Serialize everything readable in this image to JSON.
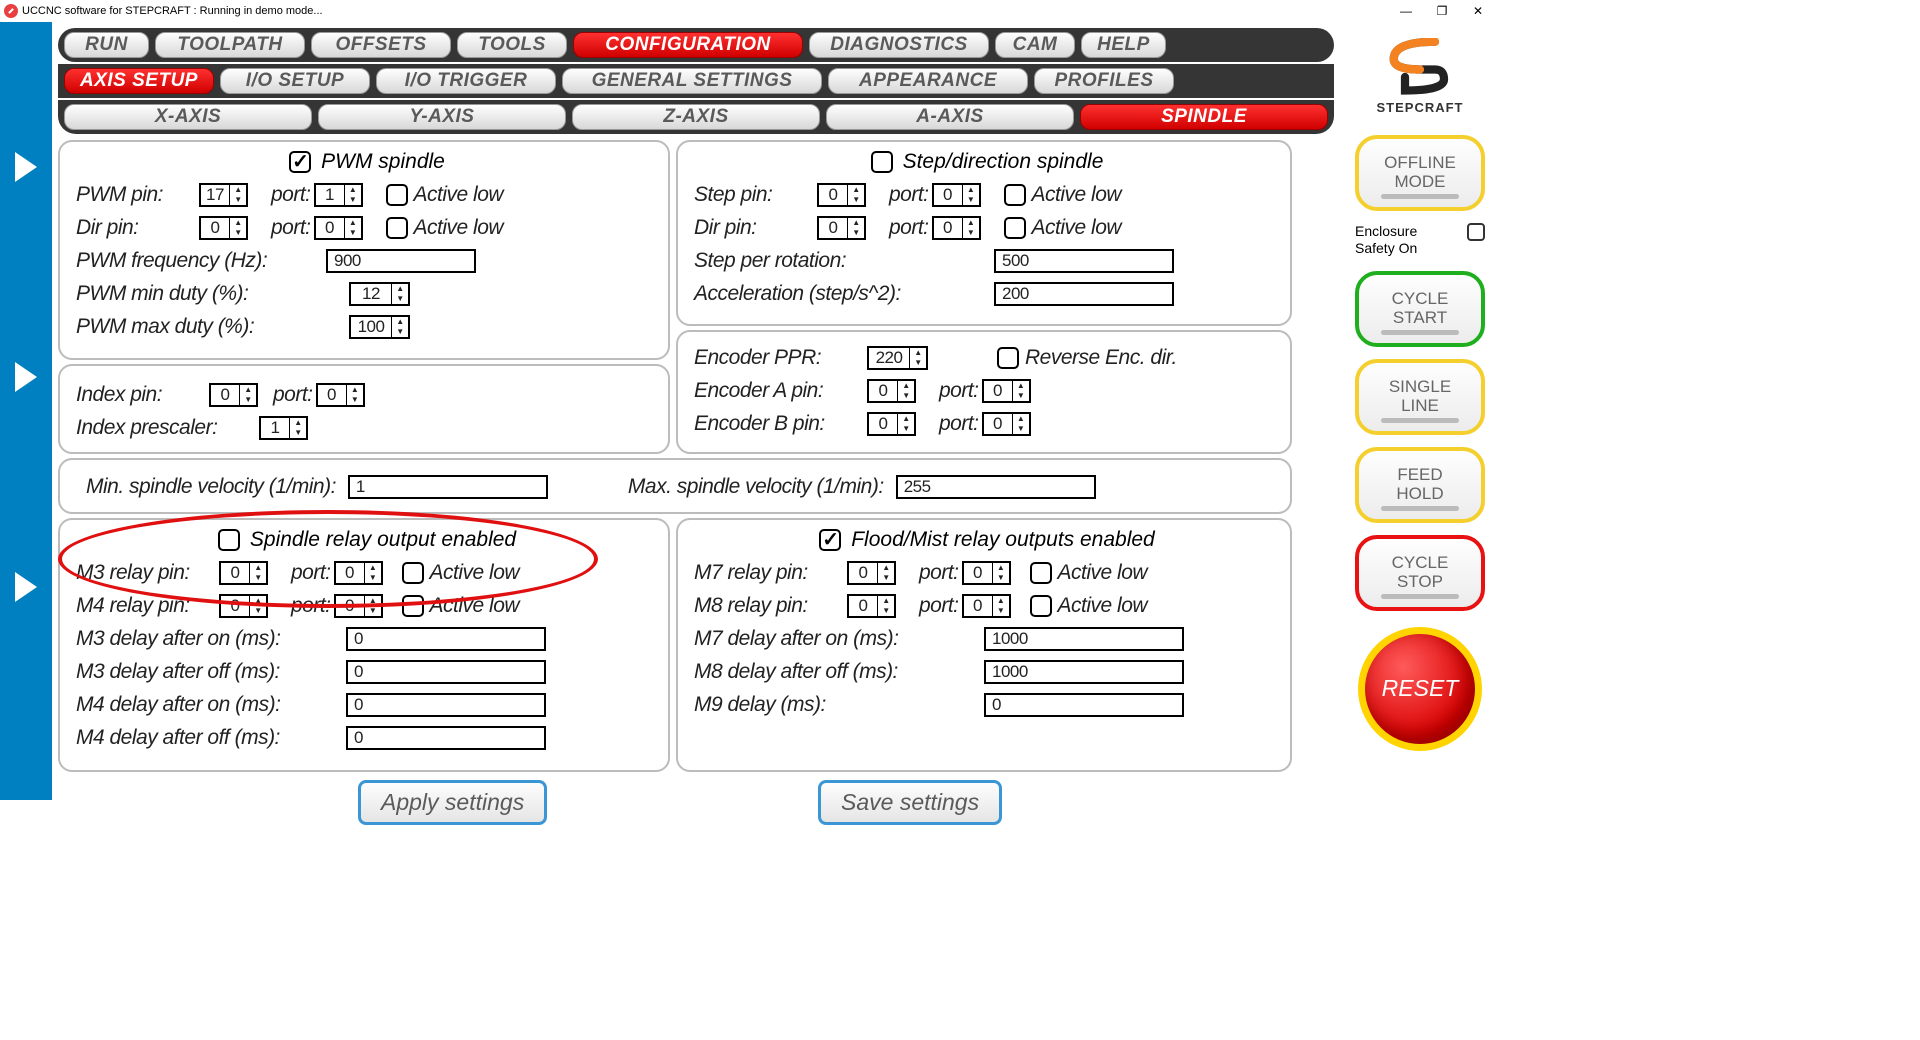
{
  "window": {
    "title": "UCCNC software for STEPCRAFT : Running in demo mode..."
  },
  "brand": "STEPCRAFT",
  "tabs_main": [
    "RUN",
    "TOOLPATH",
    "OFFSETS",
    "TOOLS",
    "CONFIGURATION",
    "DIAGNOSTICS",
    "CAM",
    "HELP"
  ],
  "tabs_main_active": "CONFIGURATION",
  "tabs_sub1": [
    "AXIS SETUP",
    "I/O SETUP",
    "I/O  TRIGGER",
    "GENERAL SETTINGS",
    "APPEARANCE",
    "PROFILES"
  ],
  "tabs_sub1_active": "AXIS SETUP",
  "tabs_sub2": [
    "X-AXIS",
    "Y-AXIS",
    "Z-AXIS",
    "A-AXIS",
    "SPINDLE"
  ],
  "tabs_sub2_active": "SPINDLE",
  "pwm": {
    "title": "PWM spindle",
    "checked": true,
    "pwm_pin_label": "PWM pin:",
    "pwm_pin": "17",
    "pwm_port": "1",
    "pwm_al": false,
    "dir_pin_label": "Dir pin:",
    "dir_pin": "0",
    "dir_port": "0",
    "dir_al": false,
    "freq_label": "PWM frequency (Hz):",
    "freq": "900",
    "min_label": "PWM min duty (%):",
    "min": "12",
    "max_label": "PWM max duty (%):",
    "max": "100",
    "port_label": "port:",
    "active_low_label": "Active low"
  },
  "stepdir": {
    "title": "Step/direction spindle",
    "checked": false,
    "step_pin_label": "Step pin:",
    "step_pin": "0",
    "step_port": "0",
    "step_al": false,
    "dir_pin_label": "Dir pin:",
    "dir_pin": "0",
    "dir_port": "0",
    "dir_al": false,
    "spr_label": "Step per rotation:",
    "spr": "500",
    "acc_label": "Acceleration (step/s^2):",
    "acc": "200",
    "port_label": "port:",
    "active_low_label": "Active low"
  },
  "index": {
    "pin_label": "Index pin:",
    "pin": "0",
    "port_label": "port:",
    "port": "0",
    "prescaler_label": "Index prescaler:",
    "prescaler": "1"
  },
  "encoder": {
    "ppr_label": "Encoder PPR:",
    "ppr": "220",
    "rev_label": "Reverse Enc. dir.",
    "rev": false,
    "a_pin_label": "Encoder A pin:",
    "a_pin": "0",
    "a_port": "0",
    "b_pin_label": "Encoder B pin:",
    "b_pin": "0",
    "b_port": "0",
    "port_label": "port:"
  },
  "velocity": {
    "min_label": "Min. spindle velocity (1/min):",
    "min": "1",
    "max_label": "Max. spindle velocity (1/min):",
    "max": "255"
  },
  "relay": {
    "title": "Spindle relay output enabled",
    "checked": false,
    "m3_label": "M3 relay pin:",
    "m3_pin": "0",
    "m3_port": "0",
    "m3_al": false,
    "m4_label": "M4 relay pin:",
    "m4_pin": "0",
    "m4_port": "0",
    "m4_al": false,
    "m3on_label": "M3 delay after on (ms):",
    "m3on": "0",
    "m3off_label": "M3 delay after off (ms):",
    "m3off": "0",
    "m4on_label": "M4 delay after on (ms):",
    "m4on": "0",
    "m4off_label": "M4 delay after off (ms):",
    "m4off": "0",
    "port_label": "port:",
    "active_low_label": "Active low"
  },
  "flood": {
    "title": "Flood/Mist relay outputs enabled",
    "checked": true,
    "m7_label": "M7 relay pin:",
    "m7_pin": "0",
    "m7_port": "0",
    "m7_al": false,
    "m8_label": "M8 relay pin:",
    "m8_pin": "0",
    "m8_port": "0",
    "m8_al": false,
    "m7on_label": "M7 delay after on (ms):",
    "m7on": "1000",
    "m8off_label": "M8 delay after off (ms):",
    "m8off": "1000",
    "m9_label": "M9 delay (ms):",
    "m9": "0",
    "port_label": "port:",
    "active_low_label": "Active low"
  },
  "buttons": {
    "apply": "Apply settings",
    "save": "Save settings"
  },
  "side": {
    "offline": "OFFLINE\nMODE",
    "enclosure": "Enclosure\nSafety On",
    "cycle_start": "CYCLE\nSTART",
    "single": "SINGLE\nLINE",
    "feed": "FEED\nHOLD",
    "stop": "CYCLE\nSTOP",
    "reset": "RESET"
  }
}
